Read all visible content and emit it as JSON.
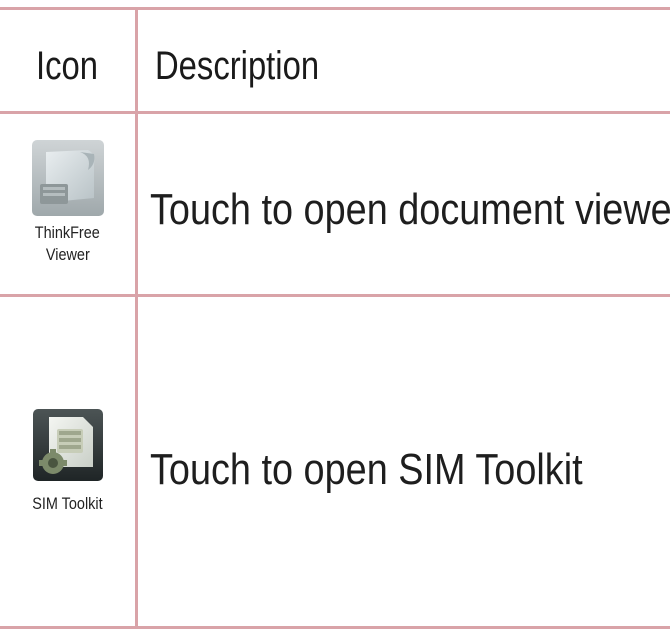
{
  "table": {
    "headers": {
      "icon": "Icon",
      "description": "Description"
    },
    "rows": [
      {
        "icon_name": "thinkfree-viewer-icon",
        "icon_label_line1": "ThinkFree",
        "icon_label_line2": "Viewer",
        "description": "Touch to open document viewer"
      },
      {
        "icon_name": "sim-toolkit-icon",
        "icon_label_line1": "SIM Toolkit",
        "description": "Touch to open SIM Toolkit"
      }
    ]
  },
  "colors": {
    "rule_lines": "#d9a3a8",
    "text": "#1a1a1a"
  }
}
